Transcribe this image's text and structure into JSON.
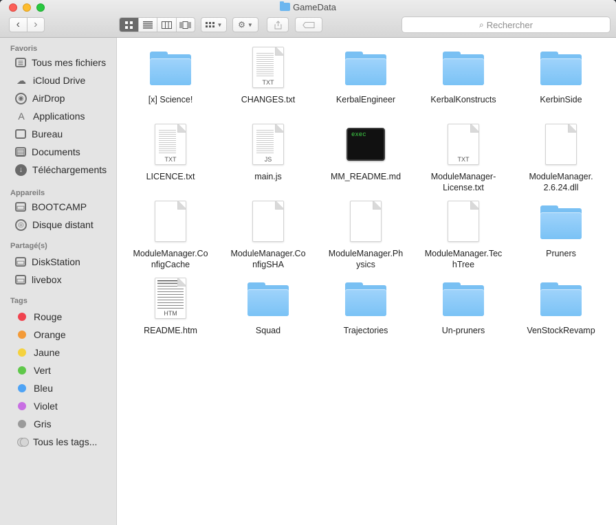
{
  "window": {
    "title": "GameData"
  },
  "toolbar": {
    "back_icon": "‹",
    "forward_icon": "›",
    "views": [
      "icon-view",
      "list-view",
      "column-view",
      "coverflow-view"
    ],
    "search_placeholder": "Rechercher"
  },
  "sidebar": {
    "sections": [
      {
        "title": "Favoris",
        "items": [
          {
            "label": "Tous mes fichiers",
            "icon": "all-files-icon"
          },
          {
            "label": "iCloud Drive",
            "icon": "cloud-icon"
          },
          {
            "label": "AirDrop",
            "icon": "airdrop-icon"
          },
          {
            "label": "Applications",
            "icon": "applications-icon"
          },
          {
            "label": "Bureau",
            "icon": "desktop-icon"
          },
          {
            "label": "Documents",
            "icon": "documents-icon"
          },
          {
            "label": "Téléchargements",
            "icon": "download-icon"
          }
        ]
      },
      {
        "title": "Appareils",
        "items": [
          {
            "label": "BOOTCAMP",
            "icon": "disk-icon"
          },
          {
            "label": "Disque distant",
            "icon": "remote-disc-icon"
          }
        ]
      },
      {
        "title": "Partagé(s)",
        "items": [
          {
            "label": "DiskStation",
            "icon": "server-icon"
          },
          {
            "label": "livebox",
            "icon": "server-icon"
          }
        ]
      },
      {
        "title": "Tags",
        "items": [
          {
            "label": "Rouge",
            "color": "#f0434f"
          },
          {
            "label": "Orange",
            "color": "#f39a38"
          },
          {
            "label": "Jaune",
            "color": "#f5d23e"
          },
          {
            "label": "Vert",
            "color": "#5fc84a"
          },
          {
            "label": "Bleu",
            "color": "#4ea3f5"
          },
          {
            "label": "Violet",
            "color": "#c86fe3"
          },
          {
            "label": "Gris",
            "color": "#9a9a9a"
          },
          {
            "label": "Tous les tags...",
            "color": ""
          }
        ]
      }
    ]
  },
  "files": [
    {
      "name": "[x] Science!",
      "kind": "folder"
    },
    {
      "name": "CHANGES.txt",
      "kind": "doc",
      "ext": "TXT"
    },
    {
      "name": "KerbalEngineer",
      "kind": "folder"
    },
    {
      "name": "KerbalKonstructs",
      "kind": "folder"
    },
    {
      "name": "KerbinSide",
      "kind": "folder"
    },
    {
      "name": "LICENCE.txt",
      "kind": "doc",
      "ext": "TXT"
    },
    {
      "name": "main.js",
      "kind": "doc",
      "ext": "JS"
    },
    {
      "name": "MM_README.md",
      "kind": "exec",
      "ext": "exec"
    },
    {
      "name": "ModuleManager-\nLicense.txt",
      "kind": "doc-blank",
      "ext": "TXT"
    },
    {
      "name": "ModuleManager.\n2.6.24.dll",
      "kind": "doc-blank",
      "ext": ""
    },
    {
      "name": "ModuleManager.Co\nnfigCache",
      "kind": "doc-blank",
      "ext": ""
    },
    {
      "name": "ModuleManager.Co\nnfigSHA",
      "kind": "doc-blank",
      "ext": ""
    },
    {
      "name": "ModuleManager.Ph\nysics",
      "kind": "doc-blank",
      "ext": ""
    },
    {
      "name": "ModuleManager.Tec\nhTree",
      "kind": "doc-blank",
      "ext": ""
    },
    {
      "name": "Pruners",
      "kind": "folder"
    },
    {
      "name": "README.htm",
      "kind": "htm",
      "ext": "HTM"
    },
    {
      "name": "Squad",
      "kind": "folder"
    },
    {
      "name": "Trajectories",
      "kind": "folder"
    },
    {
      "name": "Un-pruners",
      "kind": "folder"
    },
    {
      "name": "VenStockRevamp",
      "kind": "folder"
    }
  ]
}
